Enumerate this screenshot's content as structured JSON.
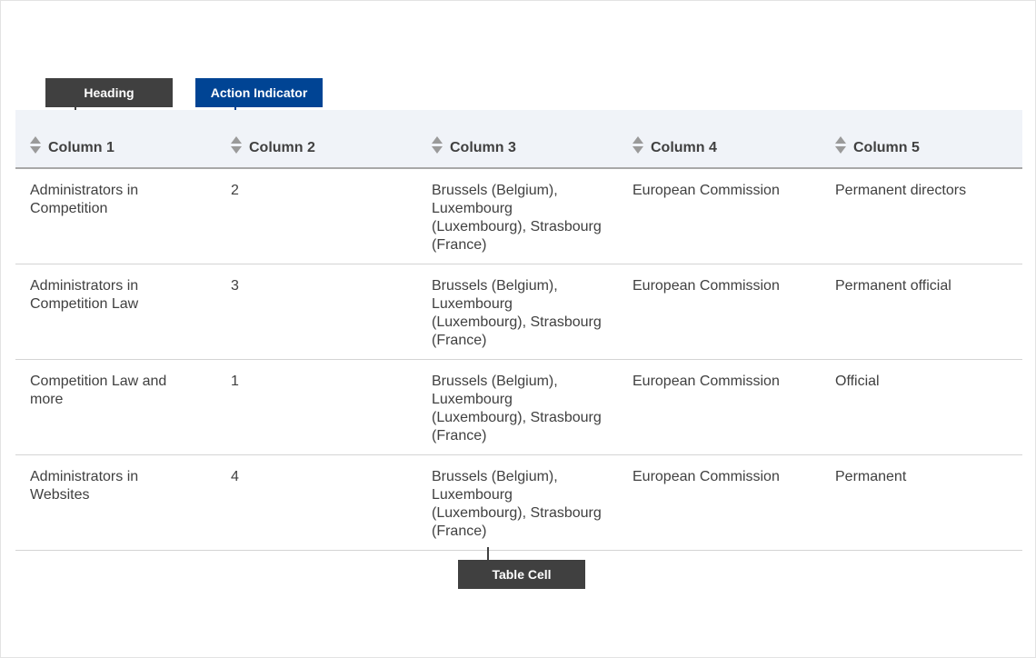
{
  "callouts": {
    "heading": "Heading",
    "action_indicator": "Action Indicator",
    "table_cell": "Table Cell"
  },
  "colors": {
    "callout_dark": "#404040",
    "callout_blue": "#004494",
    "header_bg": "#f0f3f8",
    "text": "#404040"
  },
  "table": {
    "columns": [
      "Column 1",
      "Column 2",
      "Column 3",
      "Column 4",
      "Column 5"
    ],
    "sort_icon": "sort-icon",
    "rows": [
      [
        "Administrators in Competition",
        "2",
        "Brussels (Belgium), Luxembourg (Luxembourg), Strasbourg (France)",
        "European Commission",
        "Permanent directors"
      ],
      [
        "Administrators in Competition Law",
        "3",
        "Brussels (Belgium), Luxembourg (Luxembourg), Strasbourg (France)",
        "European Commission",
        "Permanent official"
      ],
      [
        "Competition Law and more",
        "1",
        "Brussels (Belgium), Luxembourg (Luxembourg), Strasbourg (France)",
        "European Commission",
        "Official"
      ],
      [
        "Administrators in Websites",
        "4",
        "Brussels (Belgium), Luxembourg (Luxembourg), Strasbourg (France)",
        "European Commission",
        "Permanent"
      ]
    ]
  }
}
